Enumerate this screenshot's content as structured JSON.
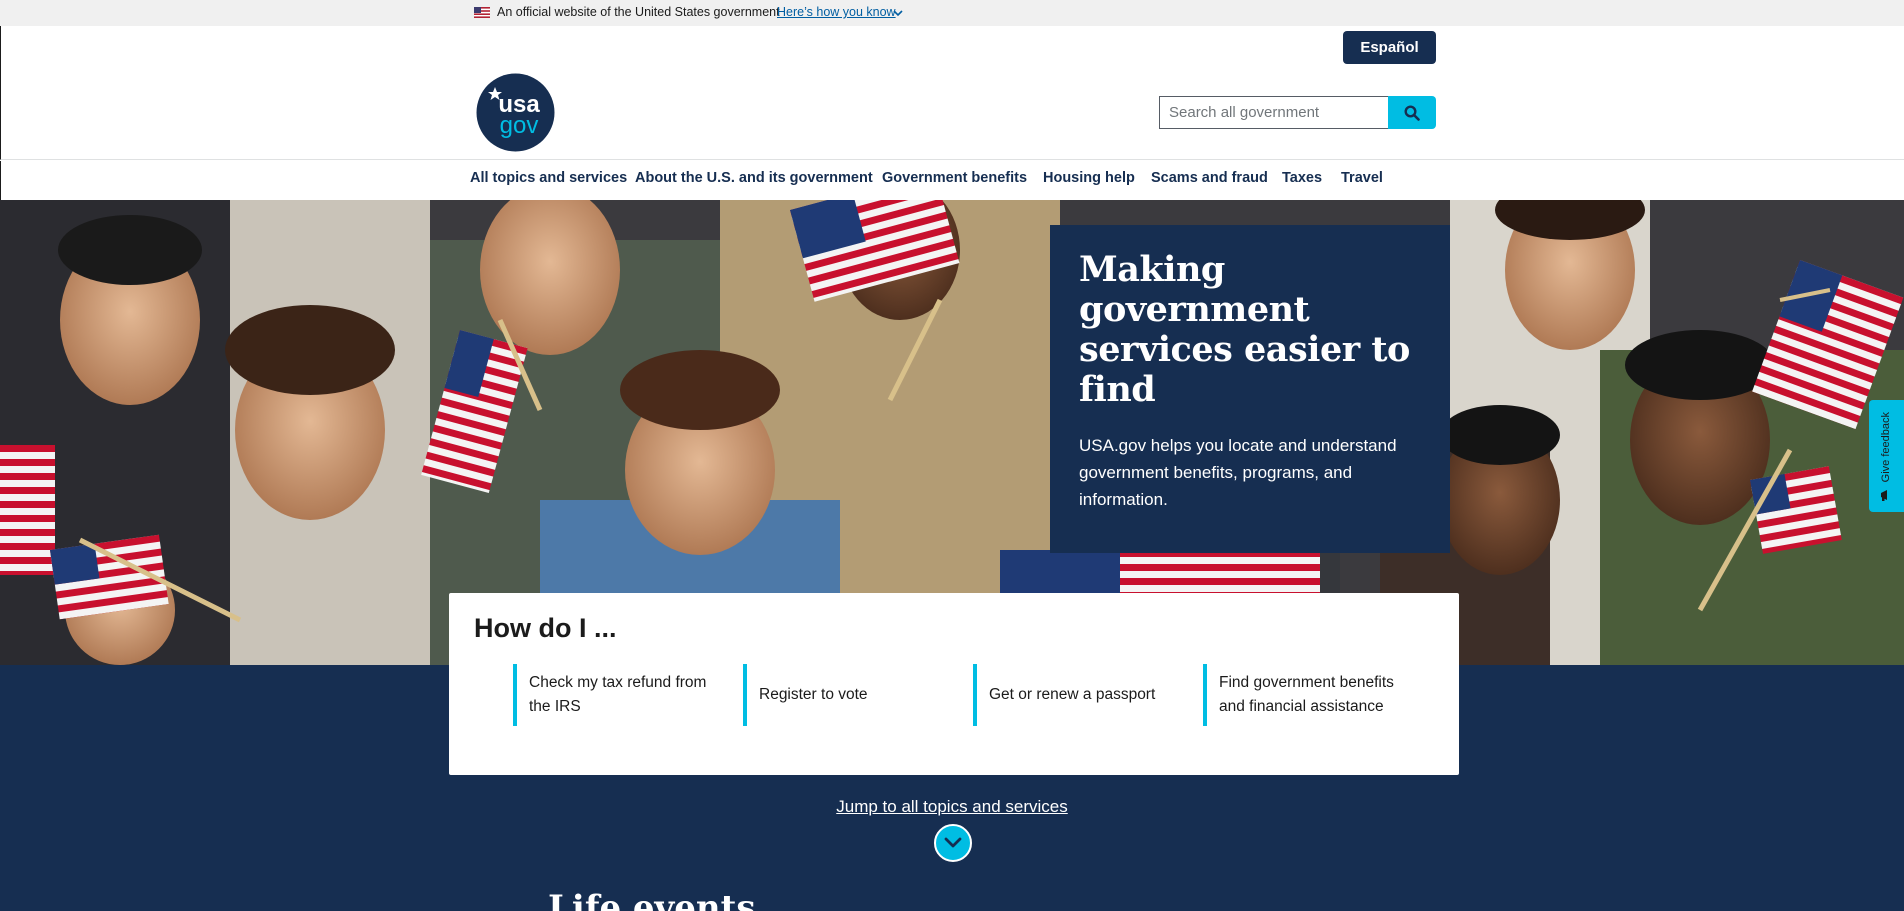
{
  "gov_banner": {
    "official_text": "An official website of the United States government",
    "how_link": "Here’s how you know"
  },
  "header": {
    "language_button": "Español",
    "logo_text_top": "usa",
    "logo_text_bottom": "gov",
    "search_placeholder": "Search all government"
  },
  "nav": {
    "items": [
      "All topics and services",
      "About the U.S. and its government",
      "Government benefits",
      "Housing help",
      "Scams and fraud",
      "Taxes",
      "Travel"
    ]
  },
  "hero": {
    "title": "Making government services easier to find",
    "text": "USA.gov helps you locate and understand government benefits, programs, and information."
  },
  "how_do_i": {
    "heading": "How do I ...",
    "items": [
      "Check my tax refund from the IRS",
      "Register to vote",
      "Get or renew a passport",
      "Find government benefits and financial assistance"
    ]
  },
  "jump_link": "Jump to all topics and services",
  "next_section_heading": "Life events",
  "feedback_tab": "Give feedback",
  "colors": {
    "navy": "#162e51",
    "cyan": "#00bde3",
    "banner_gray": "#f0f0f0",
    "link_blue": "#005ea2"
  },
  "icons": [
    "us-flag-icon",
    "chevron-down-icon",
    "search-icon",
    "arrow-down-circle-icon",
    "megaphone-icon"
  ]
}
